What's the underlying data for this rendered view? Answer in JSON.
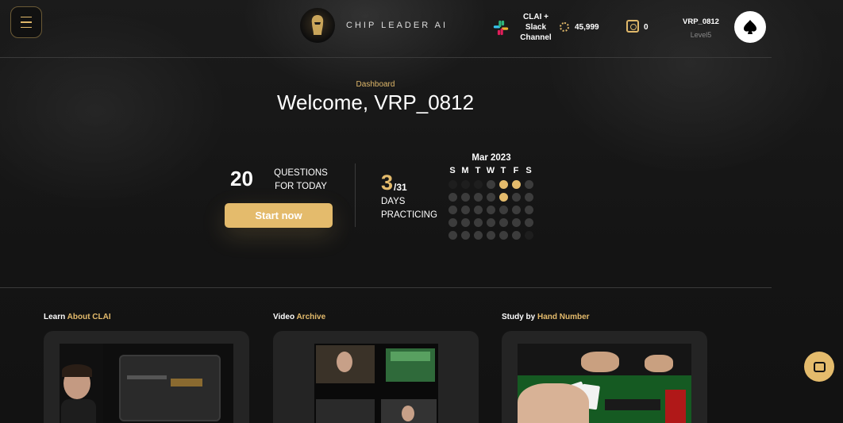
{
  "header": {
    "brand": "CHIP LEADER AI",
    "slack_label": "CLAI + Slack Channel",
    "coins": "45,999",
    "chips": "0",
    "username": "VRP_0812",
    "level": "Level5"
  },
  "dashboard": {
    "breadcrumb": "Dashboard",
    "welcome": "Welcome, VRP_0812"
  },
  "questions": {
    "count": "20",
    "label": "QUESTIONS FOR TODAY",
    "start_label": "Start now"
  },
  "practice": {
    "days": "3",
    "total": "/31",
    "label": "DAYS PRACTICING"
  },
  "calendar": {
    "month": "Mar 2023",
    "weekdays": [
      "S",
      "M",
      "T",
      "W",
      "T",
      "F",
      "S"
    ],
    "leading_empty": 3,
    "days_in_month": 31,
    "practiced_days": [
      2,
      3,
      9
    ]
  },
  "cards": [
    {
      "prefix": "Learn ",
      "highlight": "About CLAI"
    },
    {
      "prefix": "Video ",
      "highlight": "Archive"
    },
    {
      "prefix": "Study by ",
      "highlight": "Hand Number"
    }
  ],
  "colors": {
    "accent": "#e4bb6c",
    "background": "#161616",
    "card": "#242424"
  }
}
